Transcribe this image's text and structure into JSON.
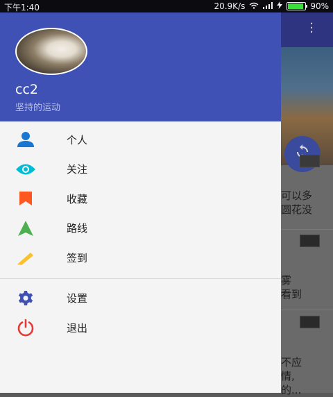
{
  "status_bar": {
    "time": "下午1:40",
    "speed": "20.9K/s",
    "battery": "90%",
    "battery_level": 0.9
  },
  "drawer": {
    "username": "cc2",
    "motto": "坚持的运动",
    "items": [
      {
        "label": "个人",
        "icon": "person-icon",
        "color": "#1976d2"
      },
      {
        "label": "关注",
        "icon": "eye-icon",
        "color": "#00bcd4"
      },
      {
        "label": "收藏",
        "icon": "bookmark-icon",
        "color": "#ff5722"
      },
      {
        "label": "路线",
        "icon": "navigation-icon",
        "color": "#4caf50"
      },
      {
        "label": "签到",
        "icon": "pencil-icon",
        "color": "#fbc02d"
      }
    ],
    "items2": [
      {
        "label": "设置",
        "icon": "gear-icon",
        "color": "#3f51b5"
      },
      {
        "label": "退出",
        "icon": "power-icon",
        "color": "#e53935"
      }
    ]
  },
  "background": {
    "text_1": "可以多\n圆花没",
    "text_2": "雾\n看到",
    "text_3": "不应\n情,\n的..."
  }
}
